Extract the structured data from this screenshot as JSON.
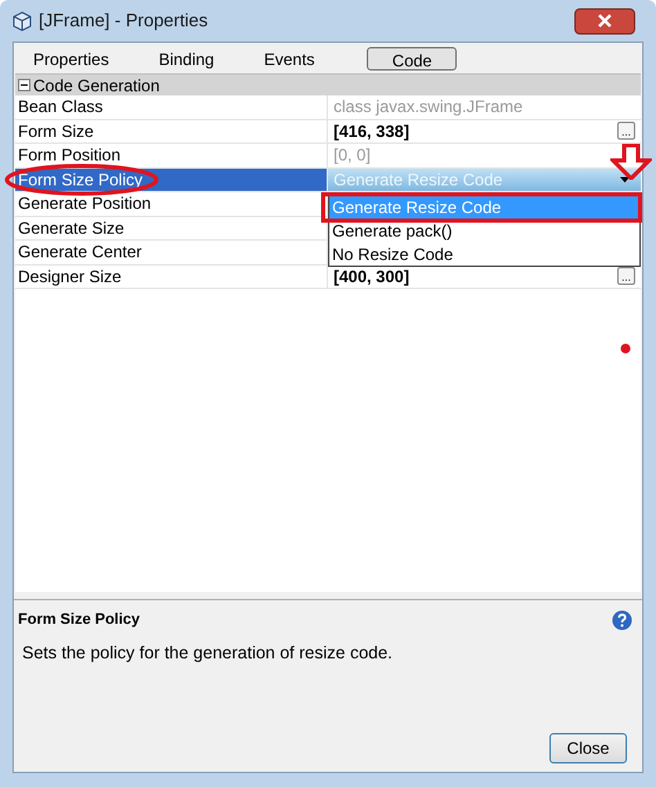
{
  "window": {
    "title": "[JFrame] - Properties"
  },
  "tabs": [
    {
      "label": "Properties",
      "selected": false
    },
    {
      "label": "Binding",
      "selected": false
    },
    {
      "label": "Events",
      "selected": false
    },
    {
      "label": "Code",
      "selected": true
    }
  ],
  "category": {
    "label": "Code Generation",
    "expanded": true
  },
  "rows": [
    {
      "name": "Bean Class",
      "value": "class javax.swing.JFrame",
      "disabled": true,
      "selected": false
    },
    {
      "name": "Form Size",
      "value": "[416, 338]",
      "disabled": false,
      "selected": false,
      "button": "..."
    },
    {
      "name": "Form Position",
      "value": "[0, 0]",
      "disabled": true,
      "selected": false
    },
    {
      "name": "Form Size Policy",
      "value": "Generate Resize Code",
      "selected": true,
      "kind": "combo"
    },
    {
      "name": "Generate Position",
      "selected": false
    },
    {
      "name": "Generate Size",
      "selected": false
    },
    {
      "name": "Generate Center",
      "selected": false
    },
    {
      "name": "Designer Size",
      "value": "[400, 300]",
      "disabled": false,
      "selected": false,
      "button": "..."
    }
  ],
  "dropdown": {
    "options": [
      {
        "label": "Generate Resize Code",
        "selected": true
      },
      {
        "label": "Generate pack()",
        "selected": false
      },
      {
        "label": "No Resize Code",
        "selected": false
      }
    ]
  },
  "description": {
    "title": "Form Size Policy",
    "text": "Sets the policy for the generation of resize code."
  },
  "buttons": [
    "Close"
  ]
}
